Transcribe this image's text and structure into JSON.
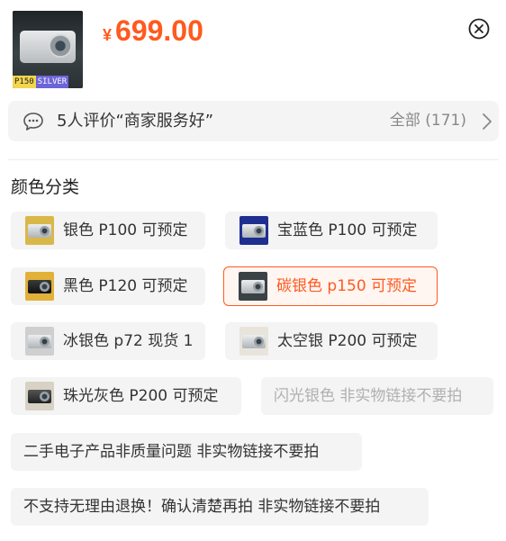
{
  "header": {
    "thumb_tag_model": "P150",
    "thumb_tag_color": "SILVER",
    "currency_symbol": "¥",
    "price": "699.00",
    "close_icon": "close-circle-icon",
    "price_color": "#ff5a1f"
  },
  "review_bar": {
    "icon": "chat-bubble-icon",
    "text": "5人评价“商家服务好”",
    "all_label": "全部 (171)",
    "arrow_icon": "chevron-right-icon"
  },
  "color_section": {
    "title": "颜色分类",
    "options": [
      {
        "label": "银色 P100 可预定",
        "state": "normal",
        "thumb_bg": "#d9b84a"
      },
      {
        "label": "宝蓝色 P100 可预定",
        "state": "normal",
        "thumb_bg": "#1f2f8f"
      },
      {
        "label": "黑色 P120 可预定",
        "state": "normal",
        "thumb_bg": "#e2b13a"
      },
      {
        "label": "碳银色 p150 可预定",
        "state": "selected",
        "thumb_bg": "#3a4245"
      },
      {
        "label": "冰银色 p72 现货 1",
        "state": "normal",
        "thumb_bg": "#cfcfcf"
      },
      {
        "label": "太空银 P200 可预定",
        "state": "normal",
        "thumb_bg": "#e8e4dc"
      },
      {
        "label": "珠光灰色 P200 可预定",
        "state": "normal",
        "thumb_bg": "#d8d2c5"
      },
      {
        "label": "闪光银色 非实物链接不要拍",
        "state": "disabled"
      },
      {
        "label": "二手电子产品非质量问题 非实物链接不要拍",
        "state": "normal"
      },
      {
        "label": "不支持无理由退换！确认清楚再拍 非实物链接不要拍",
        "state": "normal"
      }
    ]
  }
}
